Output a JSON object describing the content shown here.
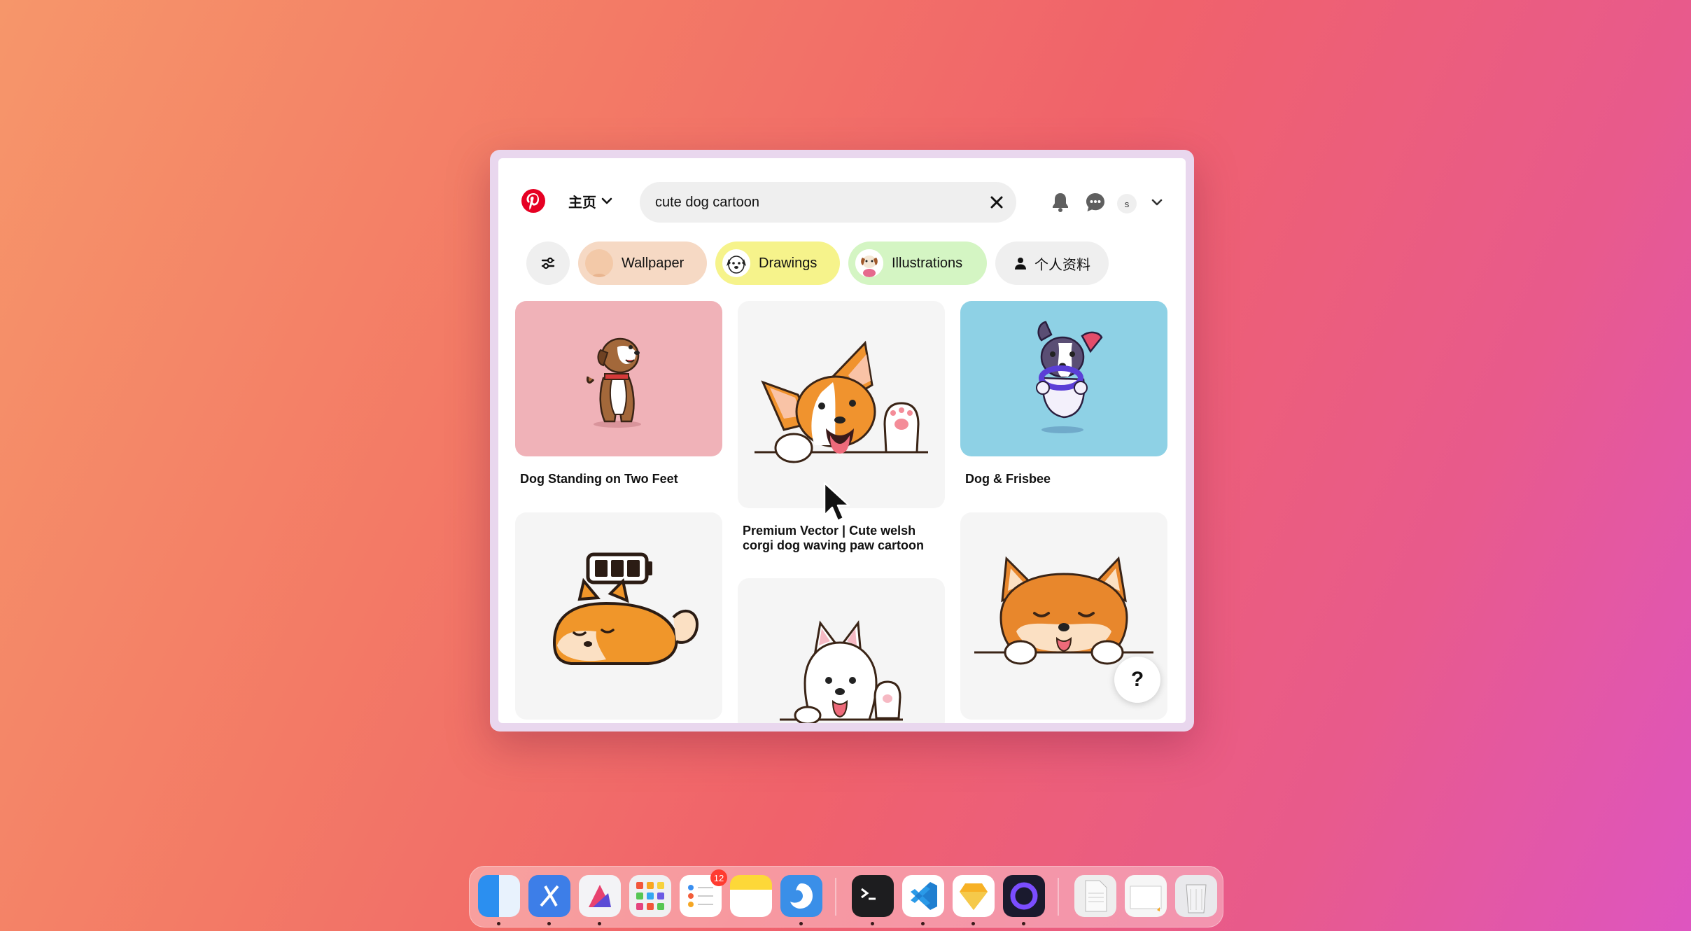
{
  "header": {
    "home_label": "主页",
    "search_value": "cute dog cartoon",
    "avatar_initial": "s"
  },
  "filters": {
    "chips": [
      {
        "label": "Wallpaper"
      },
      {
        "label": "Drawings"
      },
      {
        "label": "Illustrations"
      },
      {
        "label": "个人资料"
      }
    ]
  },
  "pins": [
    {
      "title": "Dog Standing on Two Feet"
    },
    {
      "title": "Premium Vector | Cute welsh corgi dog waving paw cartoon"
    },
    {
      "title": "Dog & Frisbee"
    },
    {
      "title": ""
    },
    {
      "title": ""
    },
    {
      "title": ""
    }
  ],
  "help_label": "?",
  "dock": {
    "items": [
      {
        "icon": "finder-icon",
        "color": "#2b8ff0"
      },
      {
        "icon": "xcode-icon",
        "color": "#3d7ee8"
      },
      {
        "icon": "affinity-icon",
        "color": "#f3f3f6"
      },
      {
        "icon": "launchpad-icon",
        "color": "#f0f0f2"
      },
      {
        "icon": "reminders-icon",
        "color": "#ffffff",
        "badge": "12"
      },
      {
        "icon": "notes-icon",
        "color": "#fdd838"
      },
      {
        "icon": "browser-icon",
        "color": "#3a8fe8"
      },
      {
        "icon": "terminal-icon",
        "color": "#1d1d1f"
      },
      {
        "icon": "vscode-icon",
        "color": "#ffffff"
      },
      {
        "icon": "sketch-icon",
        "color": "#ffffff"
      },
      {
        "icon": "arc-icon",
        "color": "#1a1a2e"
      },
      {
        "icon": "document-icon",
        "color": "#eeeeee"
      },
      {
        "icon": "folder-icon",
        "color": "#f6f6f6"
      },
      {
        "icon": "trash-icon",
        "color": "#e9e9ec"
      }
    ]
  }
}
